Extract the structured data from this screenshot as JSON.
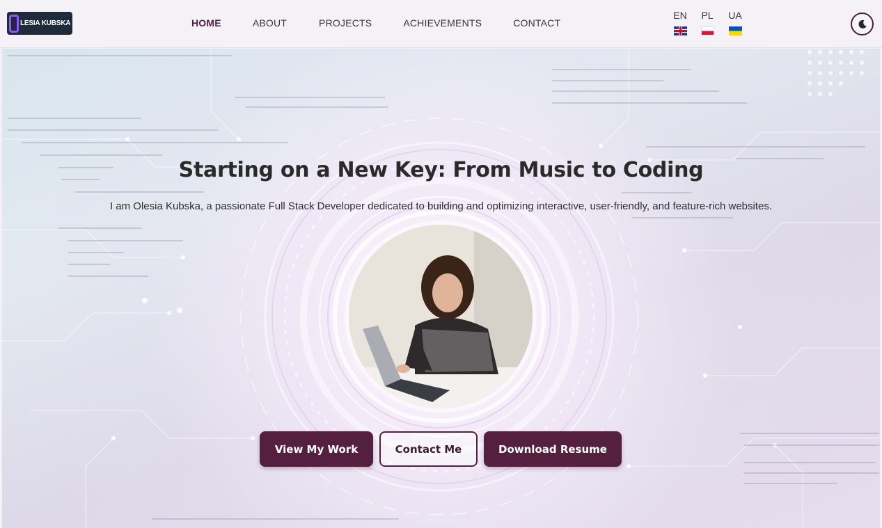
{
  "header": {
    "logo_text": "LESIA KUBSKA",
    "nav": [
      {
        "label": "HOME",
        "active": true
      },
      {
        "label": "ABOUT",
        "active": false
      },
      {
        "label": "PROJECTS",
        "active": false
      },
      {
        "label": "ACHIEVEMENTS",
        "active": false
      },
      {
        "label": "CONTACT",
        "active": false
      }
    ],
    "languages": [
      {
        "code": "EN",
        "flag": "uk-flag-icon"
      },
      {
        "code": "PL",
        "flag": "poland-flag-icon"
      },
      {
        "code": "UA",
        "flag": "ukraine-flag-icon"
      }
    ],
    "theme_toggle_icon": "moon-icon"
  },
  "hero": {
    "title": "Starting on a New Key: From Music to Coding",
    "subtitle": "I am Olesia Kubska, a passionate Full Stack Developer dedicated to building and optimizing interactive, user-friendly, and feature-rich websites.",
    "buttons": {
      "view_work": "View My Work",
      "contact": "Contact Me",
      "resume": "Download Resume"
    }
  },
  "colors": {
    "accent": "#55203f",
    "header_bg": "#f4f2f6",
    "logo_bg": "#1f2a3a",
    "logo_mark": "#8a5cf6"
  }
}
